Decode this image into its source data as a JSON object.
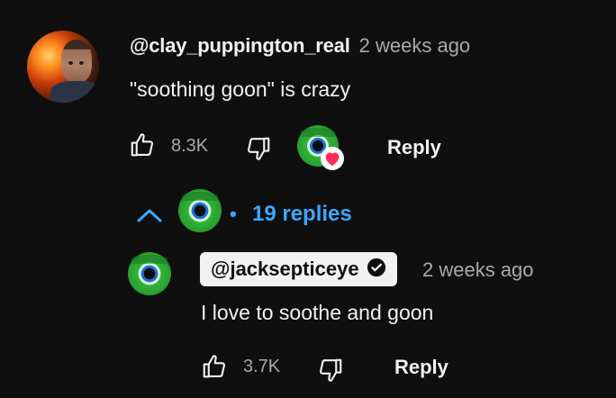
{
  "comment": {
    "author": "@clay_puppington_real",
    "time": "2 weeks ago",
    "text": "\"soothing goon\" is crazy",
    "likes": "8.3K",
    "reply_label": "Reply",
    "hearted": true
  },
  "replies_toggle": {
    "label": "19 replies",
    "separator": "•",
    "expanded": true
  },
  "reply": {
    "author": "@jacksepticeye",
    "verified": true,
    "time": "2 weeks ago",
    "text": "I love to soothe and goon",
    "likes": "3.7K",
    "reply_label": "Reply"
  },
  "colors": {
    "background": "#0f0f0f",
    "link": "#3ea6ff",
    "secondary_text": "#aaaaaa",
    "heart": "#ff2d55"
  }
}
